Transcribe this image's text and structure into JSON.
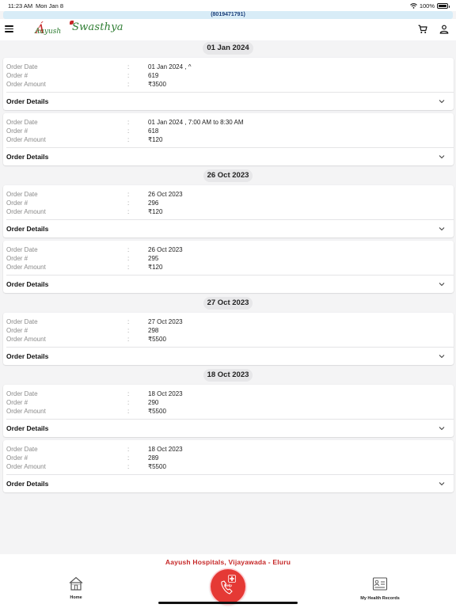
{
  "status_bar": {
    "time": "11:23 AM",
    "date": "Mon Jan 8",
    "battery": "100%",
    "battery_level": 1.0,
    "icons": [
      "wifi-icon",
      "battery-icon"
    ]
  },
  "banner": {
    "phone": "(8019471791)"
  },
  "header": {
    "logo_text_1": "Aayush",
    "logo_text_2": "Swasthya",
    "icons": [
      "menu-icon",
      "cart-icon",
      "user-icon"
    ]
  },
  "labels": {
    "order_date": "Order Date",
    "order_number": "Order #",
    "order_amount": "Order Amount",
    "colon": ":",
    "order_details": "Order Details"
  },
  "groups": [
    {
      "date": "01 Jan 2024",
      "orders": [
        {
          "date": "01 Jan 2024 , ^",
          "number": "619",
          "amount": "₹3500"
        },
        {
          "date": "01 Jan 2024 , 7:00 AM to 8:30 AM",
          "number": "618",
          "amount": "₹120"
        }
      ]
    },
    {
      "date": "26 Oct 2023",
      "orders": [
        {
          "date": "26 Oct 2023",
          "number": "296",
          "amount": "₹120"
        },
        {
          "date": "26 Oct 2023",
          "number": "295",
          "amount": "₹120"
        }
      ]
    },
    {
      "date": "27 Oct 2023",
      "orders": [
        {
          "date": "27 Oct 2023",
          "number": "298",
          "amount": "₹5500"
        }
      ]
    },
    {
      "date": "18 Oct 2023",
      "orders": [
        {
          "date": "18 Oct 2023",
          "number": "290",
          "amount": "₹5500"
        },
        {
          "date": "18 Oct 2023",
          "number": "289",
          "amount": "₹5500"
        }
      ]
    }
  ],
  "footer": {
    "hospital_text": "Aayush Hospitals,  Vijayawada - Eluru",
    "nav": {
      "home": "Home",
      "help": "Help",
      "records": "My Health Records"
    },
    "colors": {
      "accent": "#c62828",
      "help_button": "#e53935"
    }
  }
}
